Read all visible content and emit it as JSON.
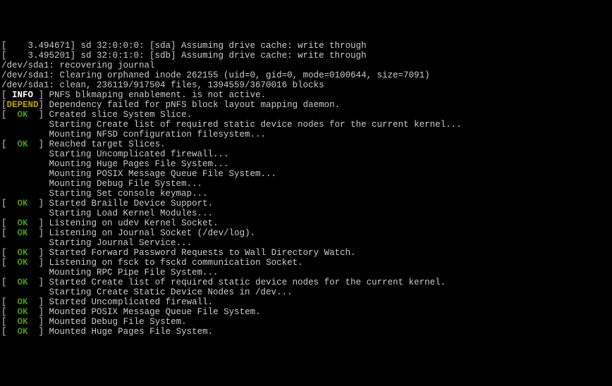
{
  "tags": {
    "ok": "  OK  ",
    "info": " INFO ",
    "depend": "DEPEND"
  },
  "lines": [
    {
      "t": "raw",
      "text": "[    3.494671] sd 32:0:0:0: [sda] Assuming drive cache: write through"
    },
    {
      "t": "raw",
      "text": "[    3.495201] sd 32:0:1:0: [sdb] Assuming drive cache: write through"
    },
    {
      "t": "raw",
      "text": "/dev/sda1: recovering journal"
    },
    {
      "t": "raw",
      "text": "/dev/sda1: Clearing orphaned inode 262155 (uid=0, gid=0, mode=0100644, size=7091)"
    },
    {
      "t": "raw",
      "text": "/dev/sda1: clean, 236119/917504 files, 1394559/3670016 blocks"
    },
    {
      "t": "tag",
      "tag": "info",
      "text": "PNFS blkmaping enablement. is not active."
    },
    {
      "t": "tag",
      "tag": "depend",
      "text": "Dependency failed for pNFS block layout mapping daemon."
    },
    {
      "t": "tag",
      "tag": "ok",
      "text": "Created slice System Slice."
    },
    {
      "t": "indent",
      "text": "Starting Create list of required static device nodes for the current kernel..."
    },
    {
      "t": "indent",
      "text": "Mounting NFSD configuration filesystem..."
    },
    {
      "t": "tag",
      "tag": "ok",
      "text": "Reached target Slices."
    },
    {
      "t": "indent",
      "text": "Starting Uncomplicated firewall..."
    },
    {
      "t": "indent",
      "text": "Mounting Huge Pages File System..."
    },
    {
      "t": "indent",
      "text": "Mounting POSIX Message Queue File System..."
    },
    {
      "t": "indent",
      "text": "Mounting Debug File System..."
    },
    {
      "t": "indent",
      "text": "Starting Set console keymap..."
    },
    {
      "t": "tag",
      "tag": "ok",
      "text": "Started Braille Device Support."
    },
    {
      "t": "indent",
      "text": "Starting Load Kernel Modules..."
    },
    {
      "t": "tag",
      "tag": "ok",
      "text": "Listening on udev Kernel Socket."
    },
    {
      "t": "tag",
      "tag": "ok",
      "text": "Listening on Journal Socket (/dev/log)."
    },
    {
      "t": "indent",
      "text": "Starting Journal Service..."
    },
    {
      "t": "tag",
      "tag": "ok",
      "text": "Started Forward Password Requests to Wall Directory Watch."
    },
    {
      "t": "tag",
      "tag": "ok",
      "text": "Listening on fsck to fsckd communication Socket."
    },
    {
      "t": "indent",
      "text": "Mounting RPC Pipe File System..."
    },
    {
      "t": "tag",
      "tag": "ok",
      "text": "Started Create list of required static device nodes for the current kernel."
    },
    {
      "t": "indent",
      "text": "Starting Create Static Device Nodes in /dev..."
    },
    {
      "t": "tag",
      "tag": "ok",
      "text": "Started Uncomplicated firewall."
    },
    {
      "t": "tag",
      "tag": "ok",
      "text": "Mounted POSIX Message Queue File System."
    },
    {
      "t": "tag",
      "tag": "ok",
      "text": "Mounted Debug File System."
    },
    {
      "t": "tag",
      "tag": "ok",
      "text": "Mounted Huge Pages File System."
    }
  ]
}
